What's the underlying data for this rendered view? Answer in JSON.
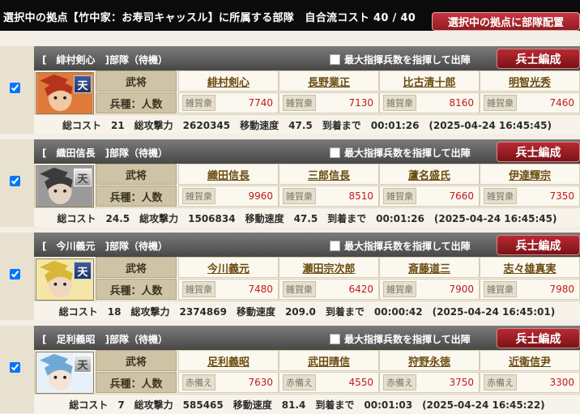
{
  "header": {
    "title": "選択中の拠点【竹中家：お寿司キャッスル】に所属する部隊　自合流コスト 40 / 40",
    "deploy_button": "選択中の拠点に部隊配置"
  },
  "labels": {
    "max_checkbox": "最大指揮兵数を指揮して出陣",
    "formation_button": "兵士編成",
    "general_row": "武将",
    "troop_row": "兵種：人数",
    "badge": "天"
  },
  "units": [
    {
      "name": "[　緋村剣心　]部隊（待機）",
      "badge_style": "blue",
      "colors": {
        "bg1": "#b5341e",
        "bg2": "#e07a3a",
        "skin": "#f2c7a4"
      },
      "generals": [
        "緋村剣心",
        "長野業正",
        "比古清十郎",
        "明智光秀"
      ],
      "troops": [
        {
          "type": "雑賀衆",
          "count": "7740"
        },
        {
          "type": "雑賀衆",
          "count": "7130"
        },
        {
          "type": "雑賀衆",
          "count": "8160"
        },
        {
          "type": "雑賀衆",
          "count": "7460"
        }
      ],
      "stats": "総コスト　21　総攻撃力　2620345　移動速度　47.5　到着まで　00:01:26　(2025-04-24 16:45:45)"
    },
    {
      "name": "[　織田信長　]部隊（待機）",
      "badge_style": "silver",
      "colors": {
        "bg1": "#3b3b3b",
        "bg2": "#9a9a9a",
        "skin": "#e2d2c0"
      },
      "generals": [
        "織田信長",
        "三郎信長",
        "蘆名盛氏",
        "伊達輝宗"
      ],
      "troops": [
        {
          "type": "雑賀衆",
          "count": "9960"
        },
        {
          "type": "雑賀衆",
          "count": "8510"
        },
        {
          "type": "雑賀衆",
          "count": "7660"
        },
        {
          "type": "雑賀衆",
          "count": "7350"
        }
      ],
      "stats": "総コスト　24.5　総攻撃力　1506834　移動速度　47.5　到着まで　00:01:26　(2025-04-24 16:45:45)"
    },
    {
      "name": "[　今川義元　]部隊（待機）",
      "badge_style": "blue",
      "colors": {
        "bg1": "#d8b63a",
        "bg2": "#f4e6a6",
        "skin": "#efd7c2"
      },
      "generals": [
        "今川義元",
        "瀬田宗次郎",
        "斎藤道三",
        "志々雄真実"
      ],
      "troops": [
        {
          "type": "雑賀衆",
          "count": "7480"
        },
        {
          "type": "雑賀衆",
          "count": "6420"
        },
        {
          "type": "雑賀衆",
          "count": "7900"
        },
        {
          "type": "雑賀衆",
          "count": "7980"
        }
      ],
      "stats": "総コスト　18　総攻撃力　2374869　移動速度　209.0　到着まで　00:00:42　(2025-04-24 16:45:01)"
    },
    {
      "name": "[　足利義昭　]部隊（待機）",
      "badge_style": "silver",
      "colors": {
        "bg1": "#6fa9d6",
        "bg2": "#e8f1fa",
        "skin": "#f4e3d6"
      },
      "generals": [
        "足利義昭",
        "武田晴信",
        "狩野永徳",
        "近衛信尹"
      ],
      "troops": [
        {
          "type": "赤備え",
          "count": "7630"
        },
        {
          "type": "赤備え",
          "count": "4550"
        },
        {
          "type": "赤備え",
          "count": "3750"
        },
        {
          "type": "赤備え",
          "count": "3300"
        }
      ],
      "stats": "総コスト　7　総攻撃力　585465　移動速度　81.4　到着まで　00:01:03　(2025-04-24 16:45:22)"
    }
  ]
}
